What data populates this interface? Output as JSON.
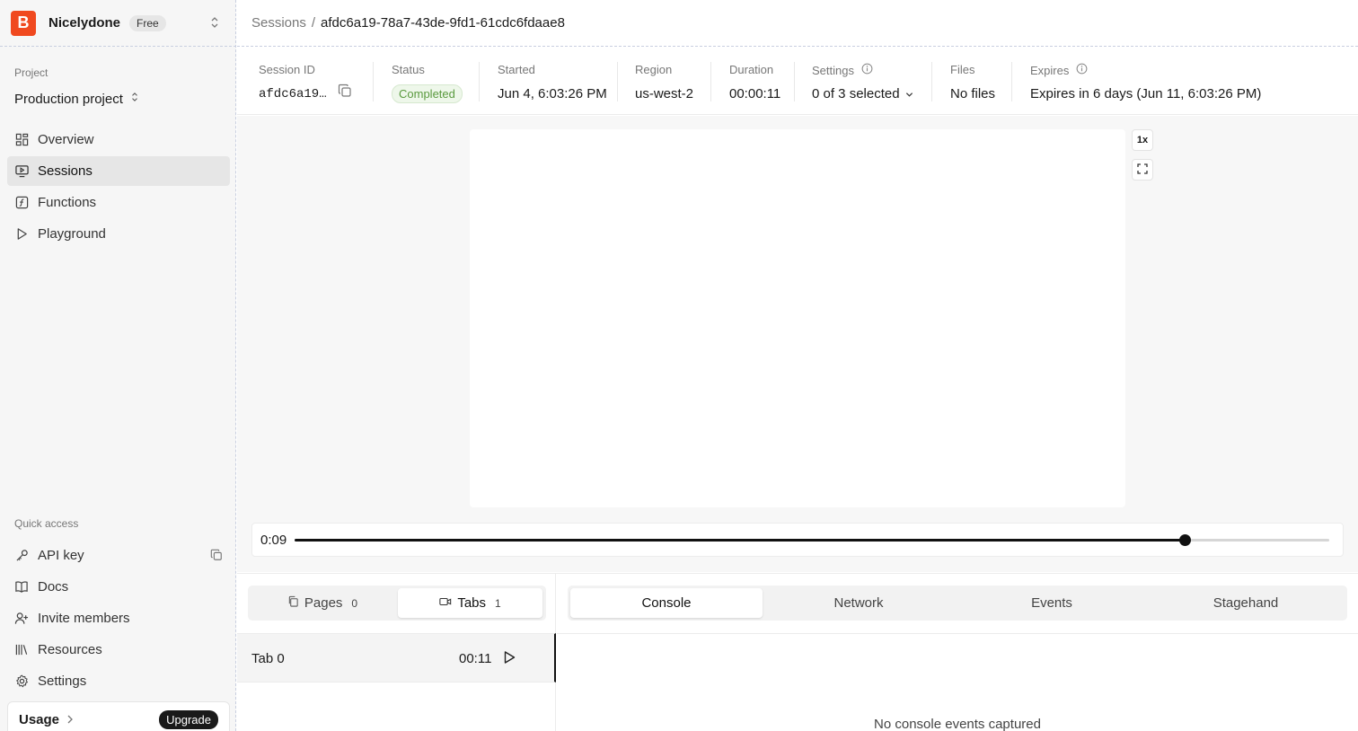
{
  "org": {
    "logo_letter": "B",
    "name": "Nicelydone",
    "plan": "Free",
    "brand_color": "#f0491f"
  },
  "sidebar": {
    "project_label": "Project",
    "project_name": "Production project",
    "nav": [
      {
        "label": "Overview",
        "icon": "grid-icon"
      },
      {
        "label": "Sessions",
        "icon": "monitor-play-icon",
        "active": true
      },
      {
        "label": "Functions",
        "icon": "function-icon"
      },
      {
        "label": "Playground",
        "icon": "play-icon"
      }
    ],
    "quick_access_label": "Quick access",
    "quick": [
      {
        "label": "API key",
        "icon": "key-icon"
      },
      {
        "label": "Docs",
        "icon": "book-icon"
      },
      {
        "label": "Invite members",
        "icon": "user-plus-icon"
      },
      {
        "label": "Resources",
        "icon": "library-icon"
      },
      {
        "label": "Settings",
        "icon": "gear-icon"
      }
    ],
    "usage_label": "Usage",
    "upgrade_label": "Upgrade"
  },
  "breadcrumb": {
    "root": "Sessions",
    "separator": "/",
    "current": "afdc6a19-78a7-43de-9fd1-61cdc6fdaae8"
  },
  "meta": {
    "session_id": {
      "label": "Session ID",
      "value": "afdc6a19…"
    },
    "status": {
      "label": "Status",
      "value": "Completed",
      "color": "#5a9a3e"
    },
    "started": {
      "label": "Started",
      "value": "Jun 4, 6:03:26 PM"
    },
    "region": {
      "label": "Region",
      "value": "us-west-2"
    },
    "duration": {
      "label": "Duration",
      "value": "00:00:11"
    },
    "settings": {
      "label": "Settings",
      "value": "0 of 3 selected"
    },
    "files": {
      "label": "Files",
      "value": "No files"
    },
    "expires": {
      "label": "Expires",
      "value": "Expires in 6 days (Jun 11, 6:03:26 PM)"
    }
  },
  "player": {
    "speed": "1x",
    "current_time": "0:09",
    "progress": 0.86
  },
  "pages_tabs": {
    "pages_label": "Pages",
    "pages_count": "0",
    "tabs_label": "Tabs",
    "tabs_count": "1",
    "rows": [
      {
        "name": "Tab 0",
        "duration": "00:11"
      }
    ]
  },
  "logs": {
    "tabs": [
      "Console",
      "Network",
      "Events",
      "Stagehand"
    ],
    "active": "Console",
    "empty_message": "No console events captured"
  }
}
